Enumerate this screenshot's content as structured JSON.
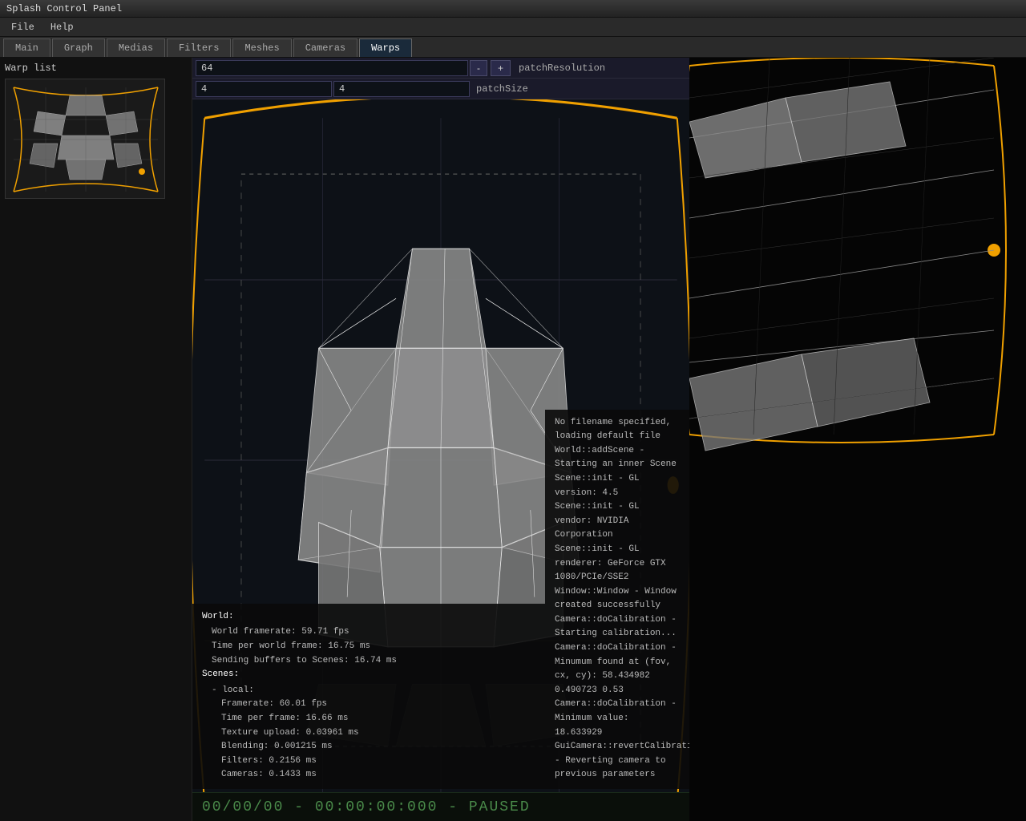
{
  "titleBar": {
    "title": "Splash Control Panel"
  },
  "menuBar": {
    "items": [
      "File",
      "Help"
    ]
  },
  "tabBar": {
    "tabs": [
      "Main",
      "Graph",
      "Medias",
      "Filters",
      "Meshes",
      "Cameras",
      "Warps"
    ],
    "activeTab": "Warps"
  },
  "warpList": {
    "title": "Warp list"
  },
  "controls": {
    "patchResolution": {
      "value": "64",
      "value2": "",
      "label": "patchResolution",
      "minus": "-",
      "plus": "+"
    },
    "patchSize": {
      "value": "4",
      "value2": "4",
      "label": "patchSize"
    }
  },
  "stats": {
    "worldLabel": "World:",
    "worldFramerate": "World framerate: 59.71 fps",
    "timePerWorldFrame": "Time per world frame: 16.75 ms",
    "sendingBuffers": "Sending buffers to Scenes: 16.74 ms",
    "scenesLabel": "Scenes:",
    "localLabel": "- local:",
    "framerate": "Framerate: 60.01 fps",
    "timePerFrame": "Time per frame: 16.66 ms",
    "textureUpload": "Texture upload: 0.03961 ms",
    "blending": "Blending: 0.001215 ms",
    "filters": "Filters: 0.2156 ms",
    "cameras": "Cameras: 0.1433 ms"
  },
  "log": {
    "lines": [
      "No filename specified, loading default file",
      "World::addScene - Starting an inner Scene",
      "Scene::init - GL version: 4.5",
      "Scene::init - GL vendor: NVIDIA Corporation",
      "Scene::init - GL renderer: GeForce GTX 1080/PCIe/SSE2",
      "Window::Window - Window created successfully",
      "Camera::doCalibration - Starting calibration...",
      "Camera::doCalibration - Minumum found at (fov, cx, cy): 58.434982 0.490723 0.53",
      "Camera::doCalibration - Minimum value: 18.633929",
      "GuiCamera::revertCalibration - Reverting camera to previous parameters"
    ]
  },
  "statusBar": {
    "text": "00/00/00 - 00:00:00:000 - PAUSED"
  },
  "colors": {
    "orange": "#f0a000",
    "meshFill": "#888",
    "meshStroke": "#fff",
    "background": "#0d1117",
    "controlBg": "#1a1a2a"
  }
}
